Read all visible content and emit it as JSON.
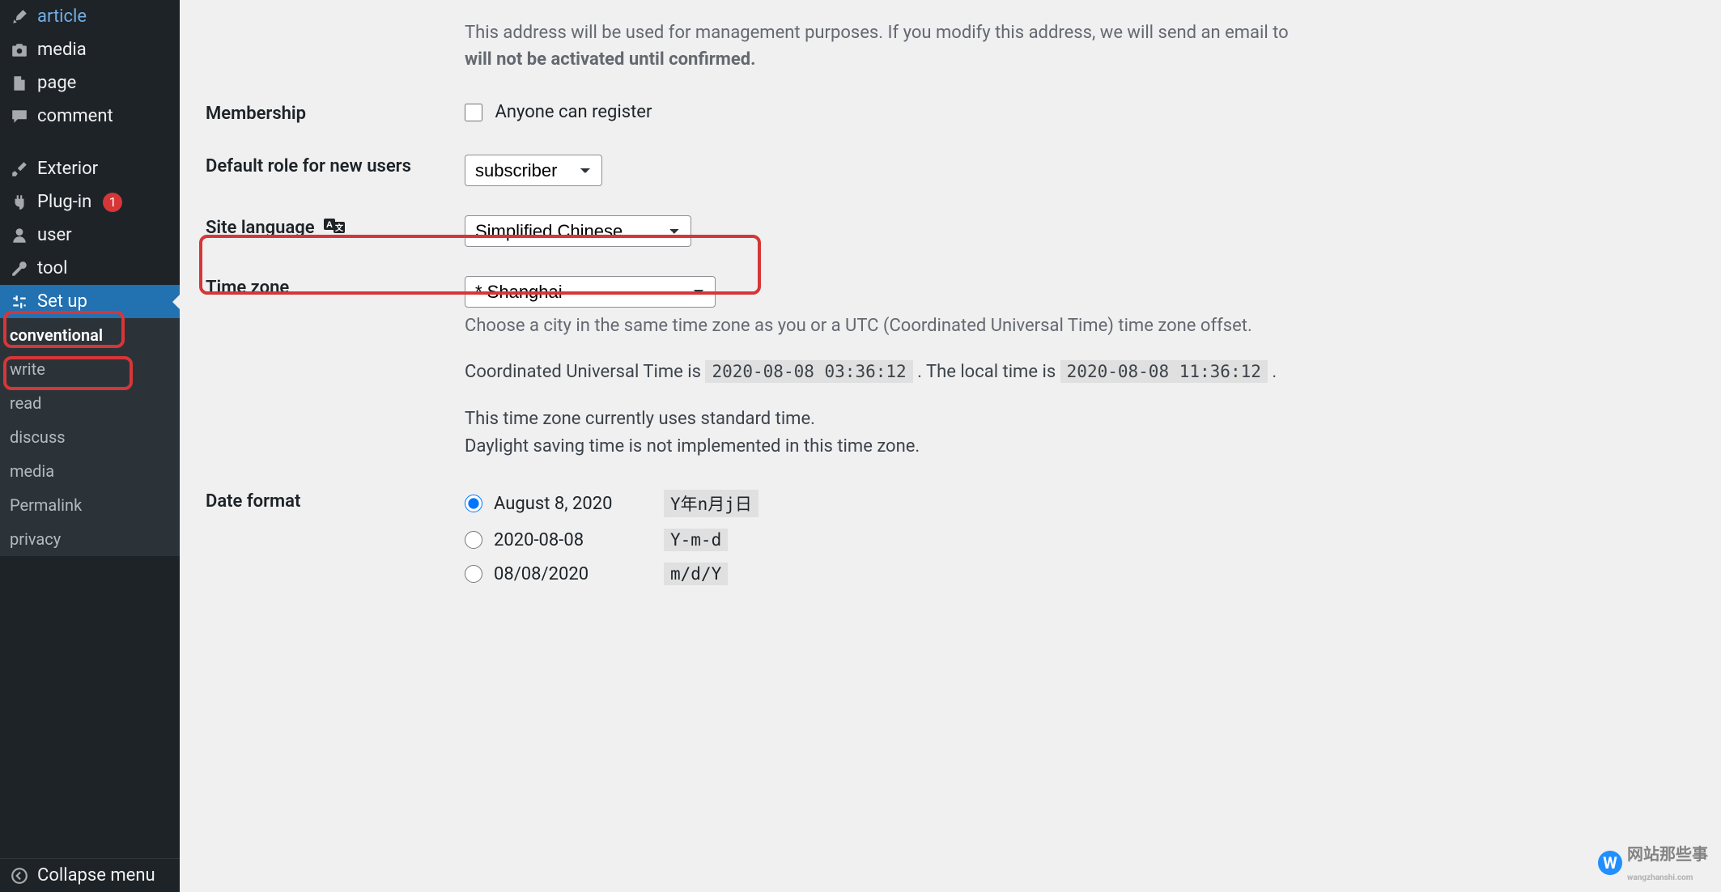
{
  "sidebar": {
    "items": [
      {
        "icon": "pin-icon",
        "label": "article"
      },
      {
        "icon": "camera-icon",
        "label": "media"
      },
      {
        "icon": "page-icon",
        "label": "page"
      },
      {
        "icon": "comment-icon",
        "label": "comment"
      },
      {
        "icon": "brush-icon",
        "label": "Exterior"
      },
      {
        "icon": "plug-icon",
        "label": "Plug-in",
        "badge": "1"
      },
      {
        "icon": "user-icon",
        "label": "user"
      },
      {
        "icon": "wrench-icon",
        "label": "tool"
      },
      {
        "icon": "sliders-icon",
        "label": "Set up",
        "active": true
      }
    ],
    "submenu": [
      {
        "label": "conventional",
        "current": true
      },
      {
        "label": "write"
      },
      {
        "label": "read"
      },
      {
        "label": "discuss"
      },
      {
        "label": "media"
      },
      {
        "label": "Permalink"
      },
      {
        "label": "privacy"
      }
    ],
    "collapse": "Collapse menu"
  },
  "settings": {
    "admin_email_desc1": "This address will be used for management purposes. If you modify this address, we will send an email to",
    "admin_email_desc2": "will not be activated until confirmed.",
    "membership_label": "Membership",
    "membership_checkbox": "Anyone can register",
    "default_role_label": "Default role for new users",
    "default_role_value": "subscriber",
    "language_label": "Site language",
    "language_value": "Simplified Chinese",
    "timezone_label": "Time zone",
    "timezone_value": "* Shanghai",
    "timezone_desc": "Choose a city in the same time zone as you or a UTC (Coordinated Universal Time) time zone offset.",
    "utc_prefix": "Coordinated Universal Time is",
    "utc_time": "2020-08-08 03:36:12",
    "local_prefix": ". The local time is",
    "local_time": "2020-08-08 11:36:12",
    "local_suffix": ".",
    "tz_line1": "This time zone currently uses standard time.",
    "tz_line2": "Daylight saving time is not implemented in this time zone.",
    "date_format_label": "Date format",
    "date_options": [
      {
        "display": "August 8, 2020",
        "code": "Y年n月j日",
        "checked": true
      },
      {
        "display": "2020-08-08",
        "code": "Y-m-d"
      },
      {
        "display": "08/08/2020",
        "code": "m/d/Y"
      }
    ]
  },
  "watermark": {
    "cn": "网站那些事",
    "dom": "wangzhanshi.com"
  }
}
